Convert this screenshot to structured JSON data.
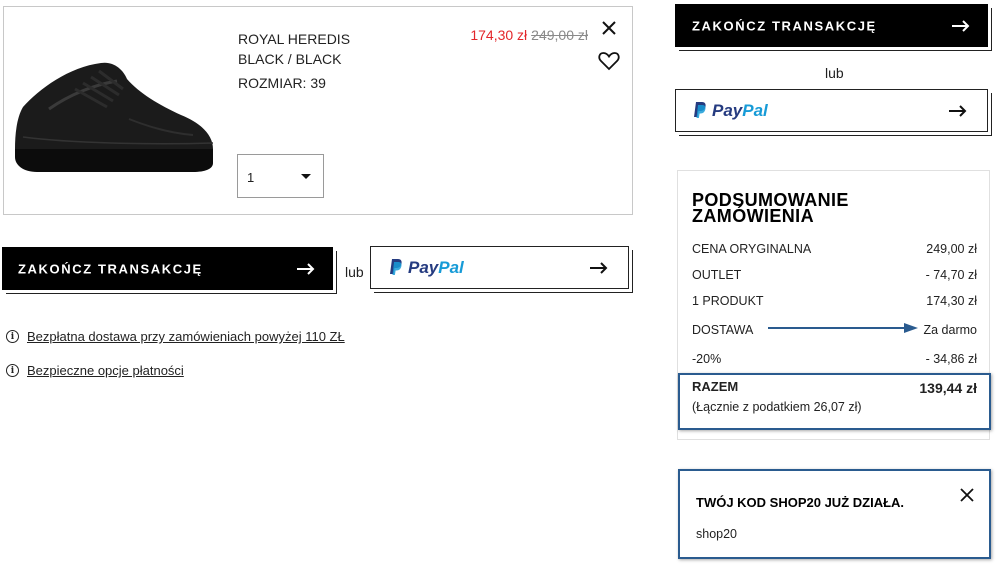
{
  "product": {
    "name_line1": "ROYAL HEREDIS",
    "name_line2": "BLACK / BLACK",
    "size": "ROZMIAR: 39",
    "sale_price": "174,30 zł",
    "original_price": "249,00 zł",
    "quantity": "1"
  },
  "checkout": {
    "finish_label": "ZAKOŃCZ TRANSAKCJĘ",
    "or_label": "lub",
    "paypal_pay": "Pay",
    "paypal_pal": "Pal"
  },
  "info": {
    "free_delivery": "Bezpłatna dostawa przy zamówieniach powyżej 110 ZŁ",
    "secure_payment": "Bezpieczne opcje płatności",
    "icon_glyph": "i"
  },
  "summary": {
    "title_line1": "PODSUMOWANIE",
    "title_line2": "ZAMÓWIENIA",
    "rows": [
      {
        "label": "CENA ORYGINALNA",
        "value": "249,00 zł"
      },
      {
        "label": "OUTLET",
        "value": "- 74,70 zł"
      },
      {
        "label": "1 PRODUKT",
        "value": "174,30 zł"
      },
      {
        "label": "DOSTAWA",
        "value": "Za darmo"
      },
      {
        "label": "-20%",
        "value": "- 34,86 zł"
      }
    ],
    "total_label": "RAZEM",
    "total_value": "139,44 zł",
    "tax_note": "(Łącznie z podatkiem  26,07 zł)"
  },
  "promo": {
    "title": "TWÓJ KOD SHOP20 JUŻ DZIAŁA.",
    "code": "shop20"
  },
  "colors": {
    "sale": "#e3262a",
    "annotation": "#2a5b8f",
    "paypal_dark": "#253b80",
    "paypal_light": "#179bd7"
  },
  "icons": [
    "close-icon",
    "heart-icon",
    "chevron-down-icon",
    "arrow-right-icon",
    "paypal-logo-icon",
    "info-icon"
  ]
}
